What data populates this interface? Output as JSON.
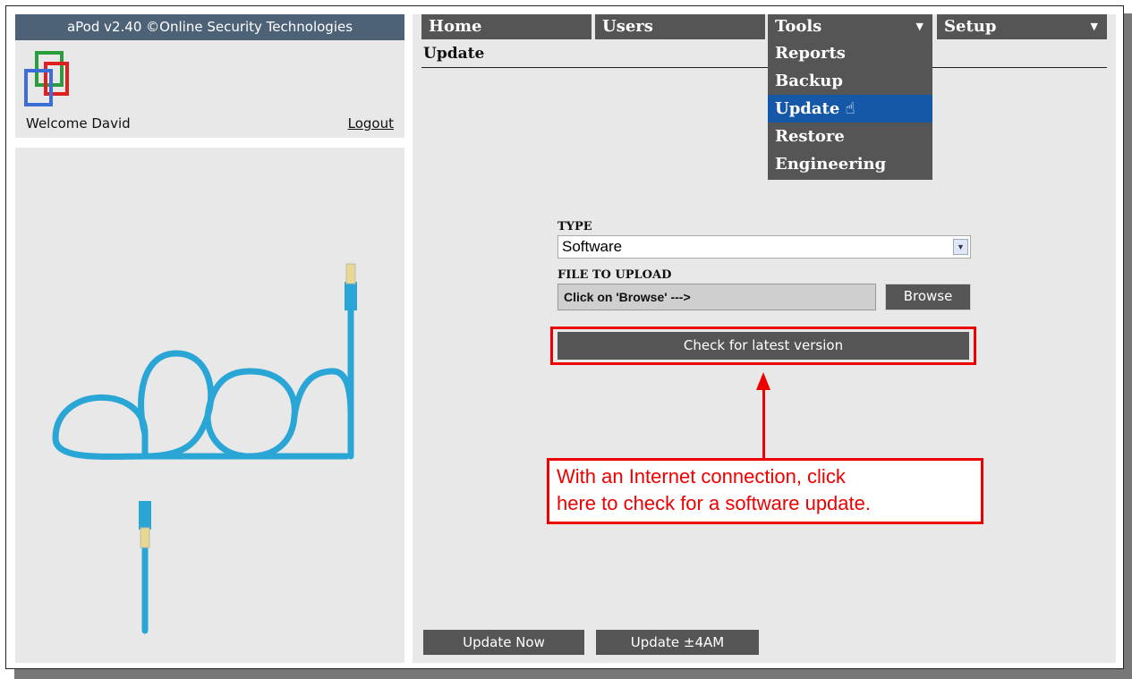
{
  "app": {
    "title": "aPod v2.40 ©Online Security Technologies"
  },
  "user": {
    "welcome": "Welcome David",
    "logout_label": "Logout"
  },
  "nav": {
    "home": "Home",
    "users": "Users",
    "tools": "Tools",
    "setup": "Setup"
  },
  "tools_menu": [
    {
      "label": "Reports",
      "active": false
    },
    {
      "label": "Backup",
      "active": false
    },
    {
      "label": "Update",
      "active": true
    },
    {
      "label": "Restore",
      "active": false
    },
    {
      "label": "Engineering",
      "active": false
    }
  ],
  "page": {
    "title": "Update"
  },
  "form": {
    "type_label": "TYPE",
    "type_value": "Software",
    "file_label": "FILE TO UPLOAD",
    "file_value": "Click on 'Browse' --->",
    "browse_label": "Browse",
    "check_label": "Check for latest version"
  },
  "callout": {
    "line1": "With an Internet connection, click",
    "line2": "here to check for a software update."
  },
  "bottom": {
    "update_now": "Update Now",
    "update_4am": "Update ±4AM"
  },
  "colors": {
    "accent": "#1558a8",
    "annotation": "#e00000",
    "header": "#4d6177",
    "button": "#555555"
  }
}
